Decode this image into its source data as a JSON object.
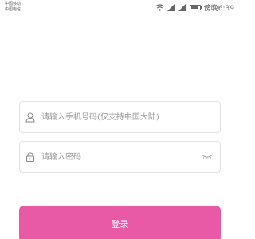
{
  "status_bar": {
    "carrier_1": "中国移动",
    "carrier_2": "中国电信",
    "time": "傍晚6:39"
  },
  "form": {
    "phone": {
      "icon": "user-icon",
      "placeholder": "请输入手机号码(仅支持中国大陆)",
      "value": ""
    },
    "password": {
      "icon": "lock-icon",
      "placeholder": "请输入密码",
      "value": "",
      "toggle_icon": "eye-closed-icon"
    },
    "login_label": "登录"
  },
  "colors": {
    "accent": "#e85aa6",
    "border": "#e2e2e2",
    "placeholder": "#999999"
  }
}
